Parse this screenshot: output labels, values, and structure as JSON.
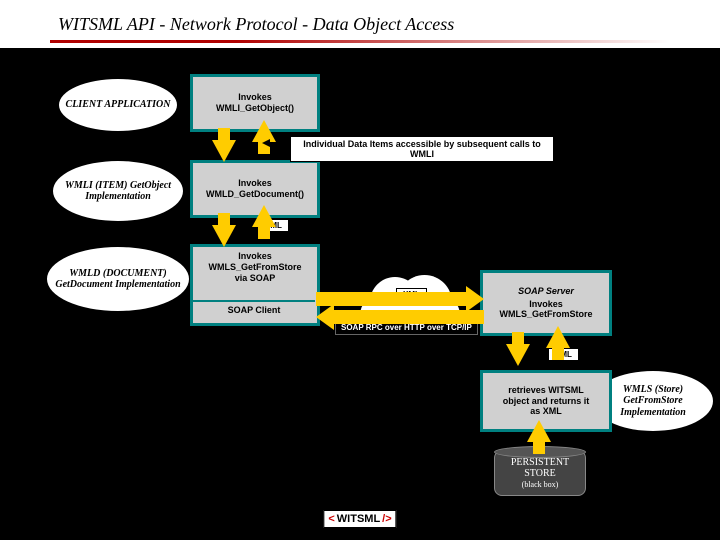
{
  "header": {
    "title": "WITSML API - Network Protocol - Data Object Access"
  },
  "ellipses": {
    "client": "CLIENT APPLICATION",
    "wmli": "WMLI (ITEM) GetObject Implementation",
    "wmld": "WMLD (DOCUMENT) GetDocument Implementation",
    "wmls": "WMLS (Store) GetFromStore Implementation"
  },
  "boxes": {
    "b1": {
      "line1": "Invokes",
      "line2": "WMLI_GetObject()"
    },
    "b2": {
      "line1": "Invokes",
      "line2": "WMLD_GetDocument()"
    },
    "b3": {
      "line1": "Invokes",
      "line2": "WMLS_GetFromStore",
      "line3": "via SOAP",
      "client": "SOAP Client"
    },
    "b4": {
      "srv": "SOAP Server",
      "line1": "Invokes",
      "line2": "WMLS_GetFromStore"
    },
    "b5": {
      "line1": "retrieves WITSML",
      "line2": "object and returns it",
      "line3": "as XML"
    }
  },
  "labels": {
    "items": "Individual Data Items accessible by subsequent calls to WMLI",
    "xml1": "XML",
    "xml2": "XML",
    "xml3": "XML",
    "soaprpc": "SOAP RPC over HTTP over TCP/IP"
  },
  "store": {
    "line1": "PERSISTENT",
    "line2": "STORE",
    "line3": "(black box)"
  },
  "logo": {
    "lt": "<",
    "text": "WITSML",
    "gt": "/>"
  }
}
